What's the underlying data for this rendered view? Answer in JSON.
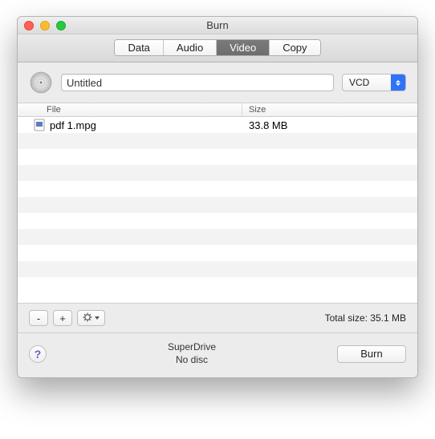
{
  "window": {
    "title": "Burn"
  },
  "tabs": {
    "data": "Data",
    "audio": "Audio",
    "video": "Video",
    "copy": "Copy",
    "active": "video"
  },
  "project": {
    "title": "Untitled",
    "format": "VCD"
  },
  "table": {
    "headers": {
      "file": "File",
      "size": "Size"
    },
    "rows": [
      {
        "file": "pdf 1.mpg",
        "size": "33.8 MB"
      }
    ]
  },
  "footer": {
    "remove": "-",
    "add": "+",
    "total_label": "Total size:",
    "total_value": "35.1 MB"
  },
  "status": {
    "drive": "SuperDrive",
    "disc": "No disc",
    "burn": "Burn"
  }
}
